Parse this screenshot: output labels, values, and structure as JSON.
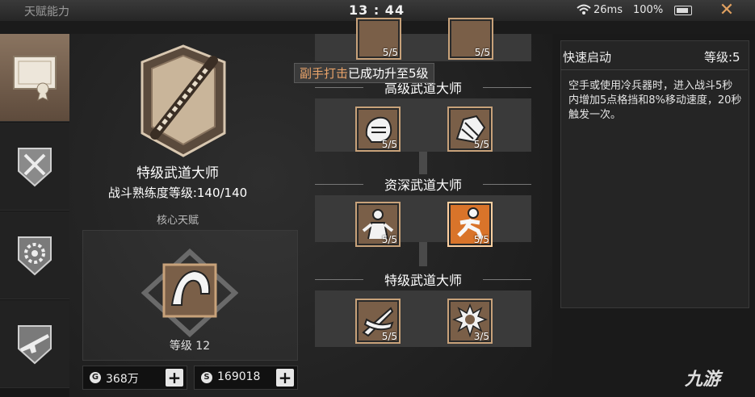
{
  "statusbar": {
    "app_title": "天赋能力",
    "clock": "13 : 44",
    "ping": "26ms",
    "battery": "100%"
  },
  "sidebar": {
    "tabs": [
      {
        "icon": "certificate-icon",
        "active": true
      },
      {
        "icon": "combat-emblem-icon",
        "active": false
      },
      {
        "icon": "gear-wrench-icon",
        "active": false
      },
      {
        "icon": "rifle-icon",
        "active": false
      }
    ]
  },
  "talent": {
    "title": "特级武道大师",
    "mastery": "战斗熟练度等级:140/140",
    "core_label": "核心天赋",
    "core_level": "等级 12"
  },
  "resources": {
    "coins": "368万",
    "coin_icon": "G",
    "silver": "169018",
    "silver_icon": "S",
    "plus": "+"
  },
  "tree": {
    "toast_highlight": "副手打击",
    "toast_rest": "已成功升至5级",
    "tiers": [
      {
        "name": "高级武道大师",
        "nodes": [
          {
            "icon": "fist-icon",
            "count": "5/5"
          },
          {
            "icon": "gauntlet-icon",
            "count": "5/5"
          }
        ]
      },
      {
        "name": "资深武道大师",
        "nodes": [
          {
            "icon": "fighter-icon",
            "count": "5/5"
          },
          {
            "icon": "runner-icon",
            "count": "5/5",
            "selected": true
          }
        ]
      },
      {
        "name": "特级武道大师",
        "nodes": [
          {
            "icon": "blades-icon",
            "count": "5/5"
          },
          {
            "icon": "spiked-icon",
            "count": "3/5"
          }
        ]
      }
    ],
    "top_counts": [
      "5/5",
      "5/5"
    ]
  },
  "detail": {
    "name": "快速启动",
    "level": "等级:5",
    "description": "空手或使用冷兵器时，进入战斗5秒内增加5点格挡和8%移动速度，20秒触发一次。"
  },
  "watermark": "九游",
  "colors": {
    "accent": "#d9742a",
    "frame": "#c8a27a"
  }
}
